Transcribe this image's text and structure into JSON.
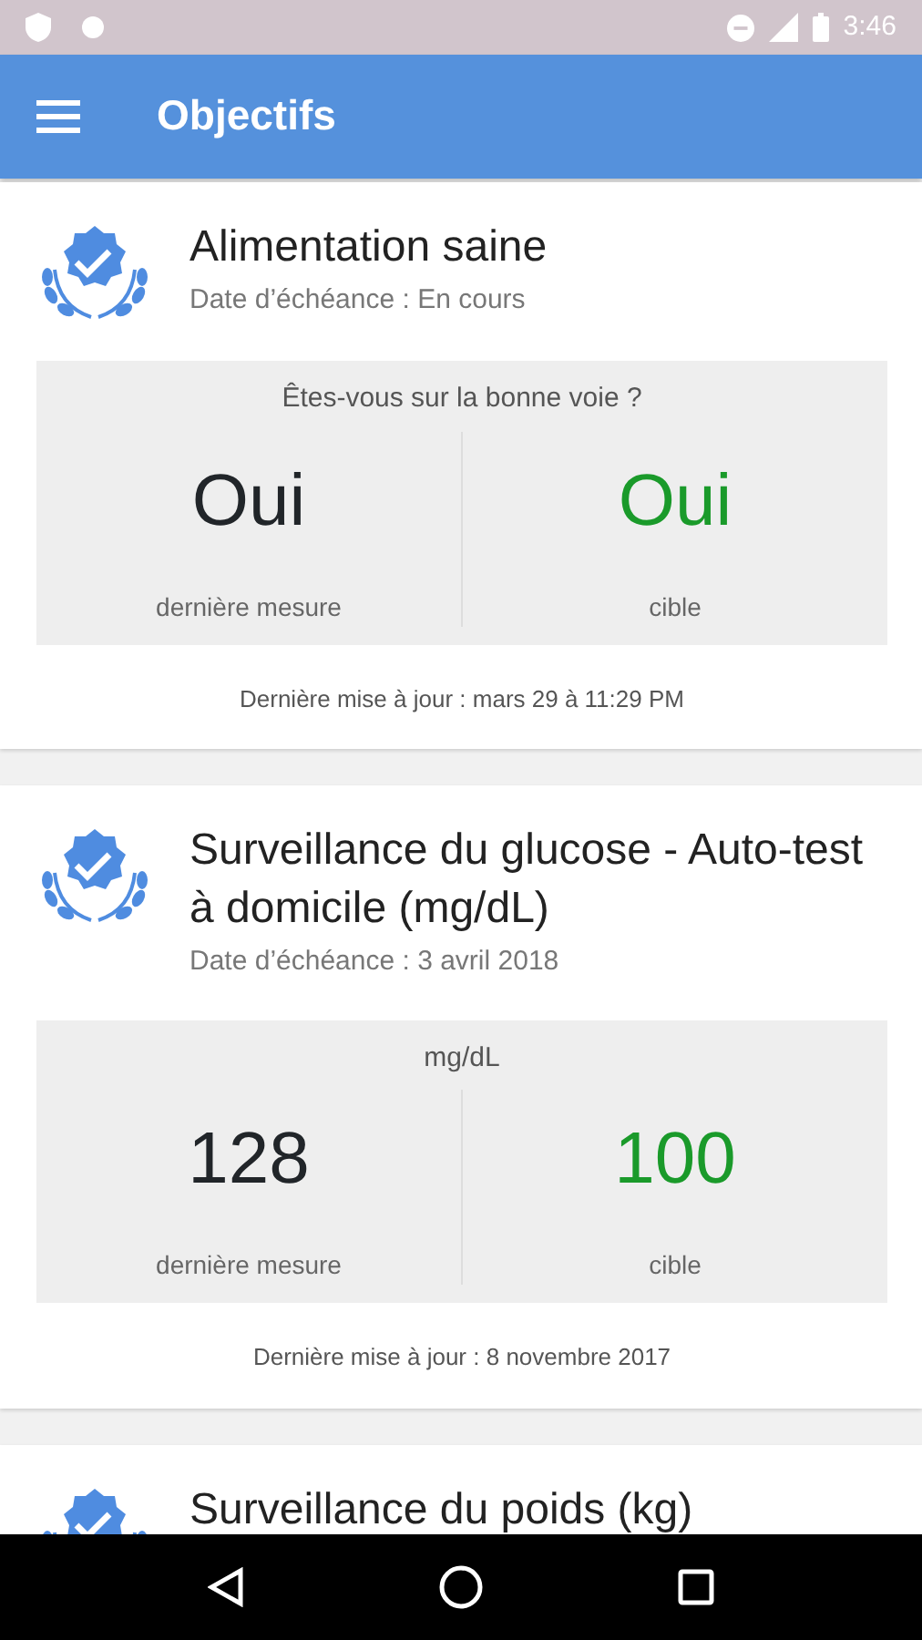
{
  "status_bar": {
    "time": "3:46"
  },
  "app_bar": {
    "title": "Objectifs"
  },
  "goals": [
    {
      "title": "Alimentation saine",
      "due": "Date d’échéance : En cours",
      "question": "Êtes-vous sur la bonne voie ?",
      "last_value": "Oui",
      "last_label": "dernière mesure",
      "target_value": "Oui",
      "target_label": "cible",
      "updated": "Dernière mise à jour : mars 29 à 11:29 PM"
    },
    {
      "title": "Surveillance du glucose - Auto-test à  domicile (mg/dL)",
      "due": "Date d’échéance : 3 avril 2018",
      "question": "mg/dL",
      "last_value": "128",
      "last_label": "dernière mesure",
      "target_value": "100",
      "target_label": "cible",
      "updated": "Dernière mise à jour : 8 novembre 2017"
    },
    {
      "title": "Surveillance du poids (kg)"
    }
  ]
}
